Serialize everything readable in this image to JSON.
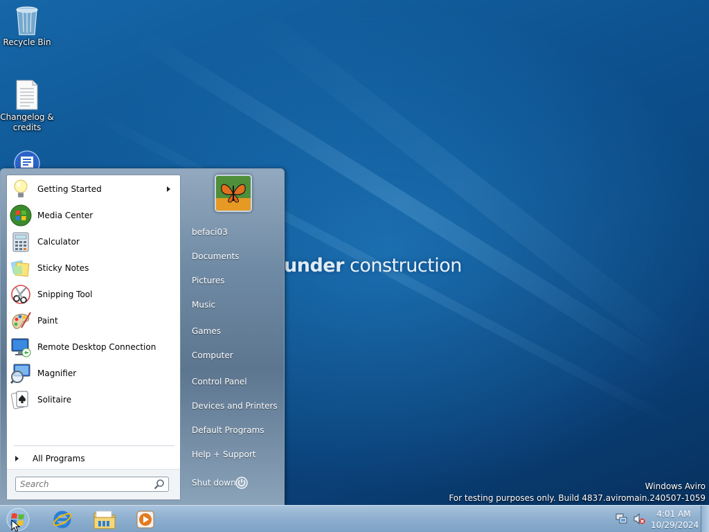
{
  "desktop": {
    "icons": [
      {
        "label": "Recycle Bin"
      },
      {
        "label": "Changelog & credits"
      },
      {
        "label": ""
      }
    ],
    "wallpaper_text": {
      "part1": "under",
      "part2": " construction"
    },
    "watermark": {
      "line1": "Windows Aviro",
      "line2": "For testing purposes only. Build 4837.aviromain.240507-1059"
    }
  },
  "start_menu": {
    "programs": [
      {
        "label": "Getting Started",
        "icon": "lightbulb-icon",
        "has_submenu": true
      },
      {
        "label": "Media Center",
        "icon": "media-center-icon"
      },
      {
        "label": "Calculator",
        "icon": "calculator-icon"
      },
      {
        "label": "Sticky Notes",
        "icon": "sticky-notes-icon"
      },
      {
        "label": "Snipping Tool",
        "icon": "scissors-icon"
      },
      {
        "label": "Paint",
        "icon": "paint-palette-icon"
      },
      {
        "label": "Remote Desktop Connection",
        "icon": "remote-desktop-icon"
      },
      {
        "label": "Magnifier",
        "icon": "magnifier-icon"
      },
      {
        "label": "Solitaire",
        "icon": "solitaire-cards-icon"
      }
    ],
    "all_programs_label": "All Programs",
    "search_placeholder": "Search",
    "user": {
      "name": "befaci03"
    },
    "right_items": [
      {
        "label": "Documents"
      },
      {
        "label": "Pictures"
      },
      {
        "label": "Music"
      },
      {
        "label": "Games"
      },
      {
        "label": "Computer"
      },
      {
        "label": "Control Panel"
      },
      {
        "label": "Devices and Printers"
      },
      {
        "label": "Default Programs"
      },
      {
        "label": "Help + Support"
      }
    ],
    "shutdown_label": "Shut down"
  },
  "taskbar": {
    "pinned": [
      {
        "name": "internet-explorer-icon"
      },
      {
        "name": "file-explorer-icon"
      },
      {
        "name": "media-player-icon"
      }
    ],
    "clock": {
      "time": "4:01 AM",
      "date": "10/29/2024"
    }
  },
  "colors": {
    "desktop_blue": "#0c4f8c",
    "taskbar": "#8fb0cf",
    "start_orb_red": "#e8452c",
    "start_orb_green": "#5bb831",
    "start_orb_blue": "#2a7fd6",
    "start_orb_yellow": "#f5c21b"
  }
}
